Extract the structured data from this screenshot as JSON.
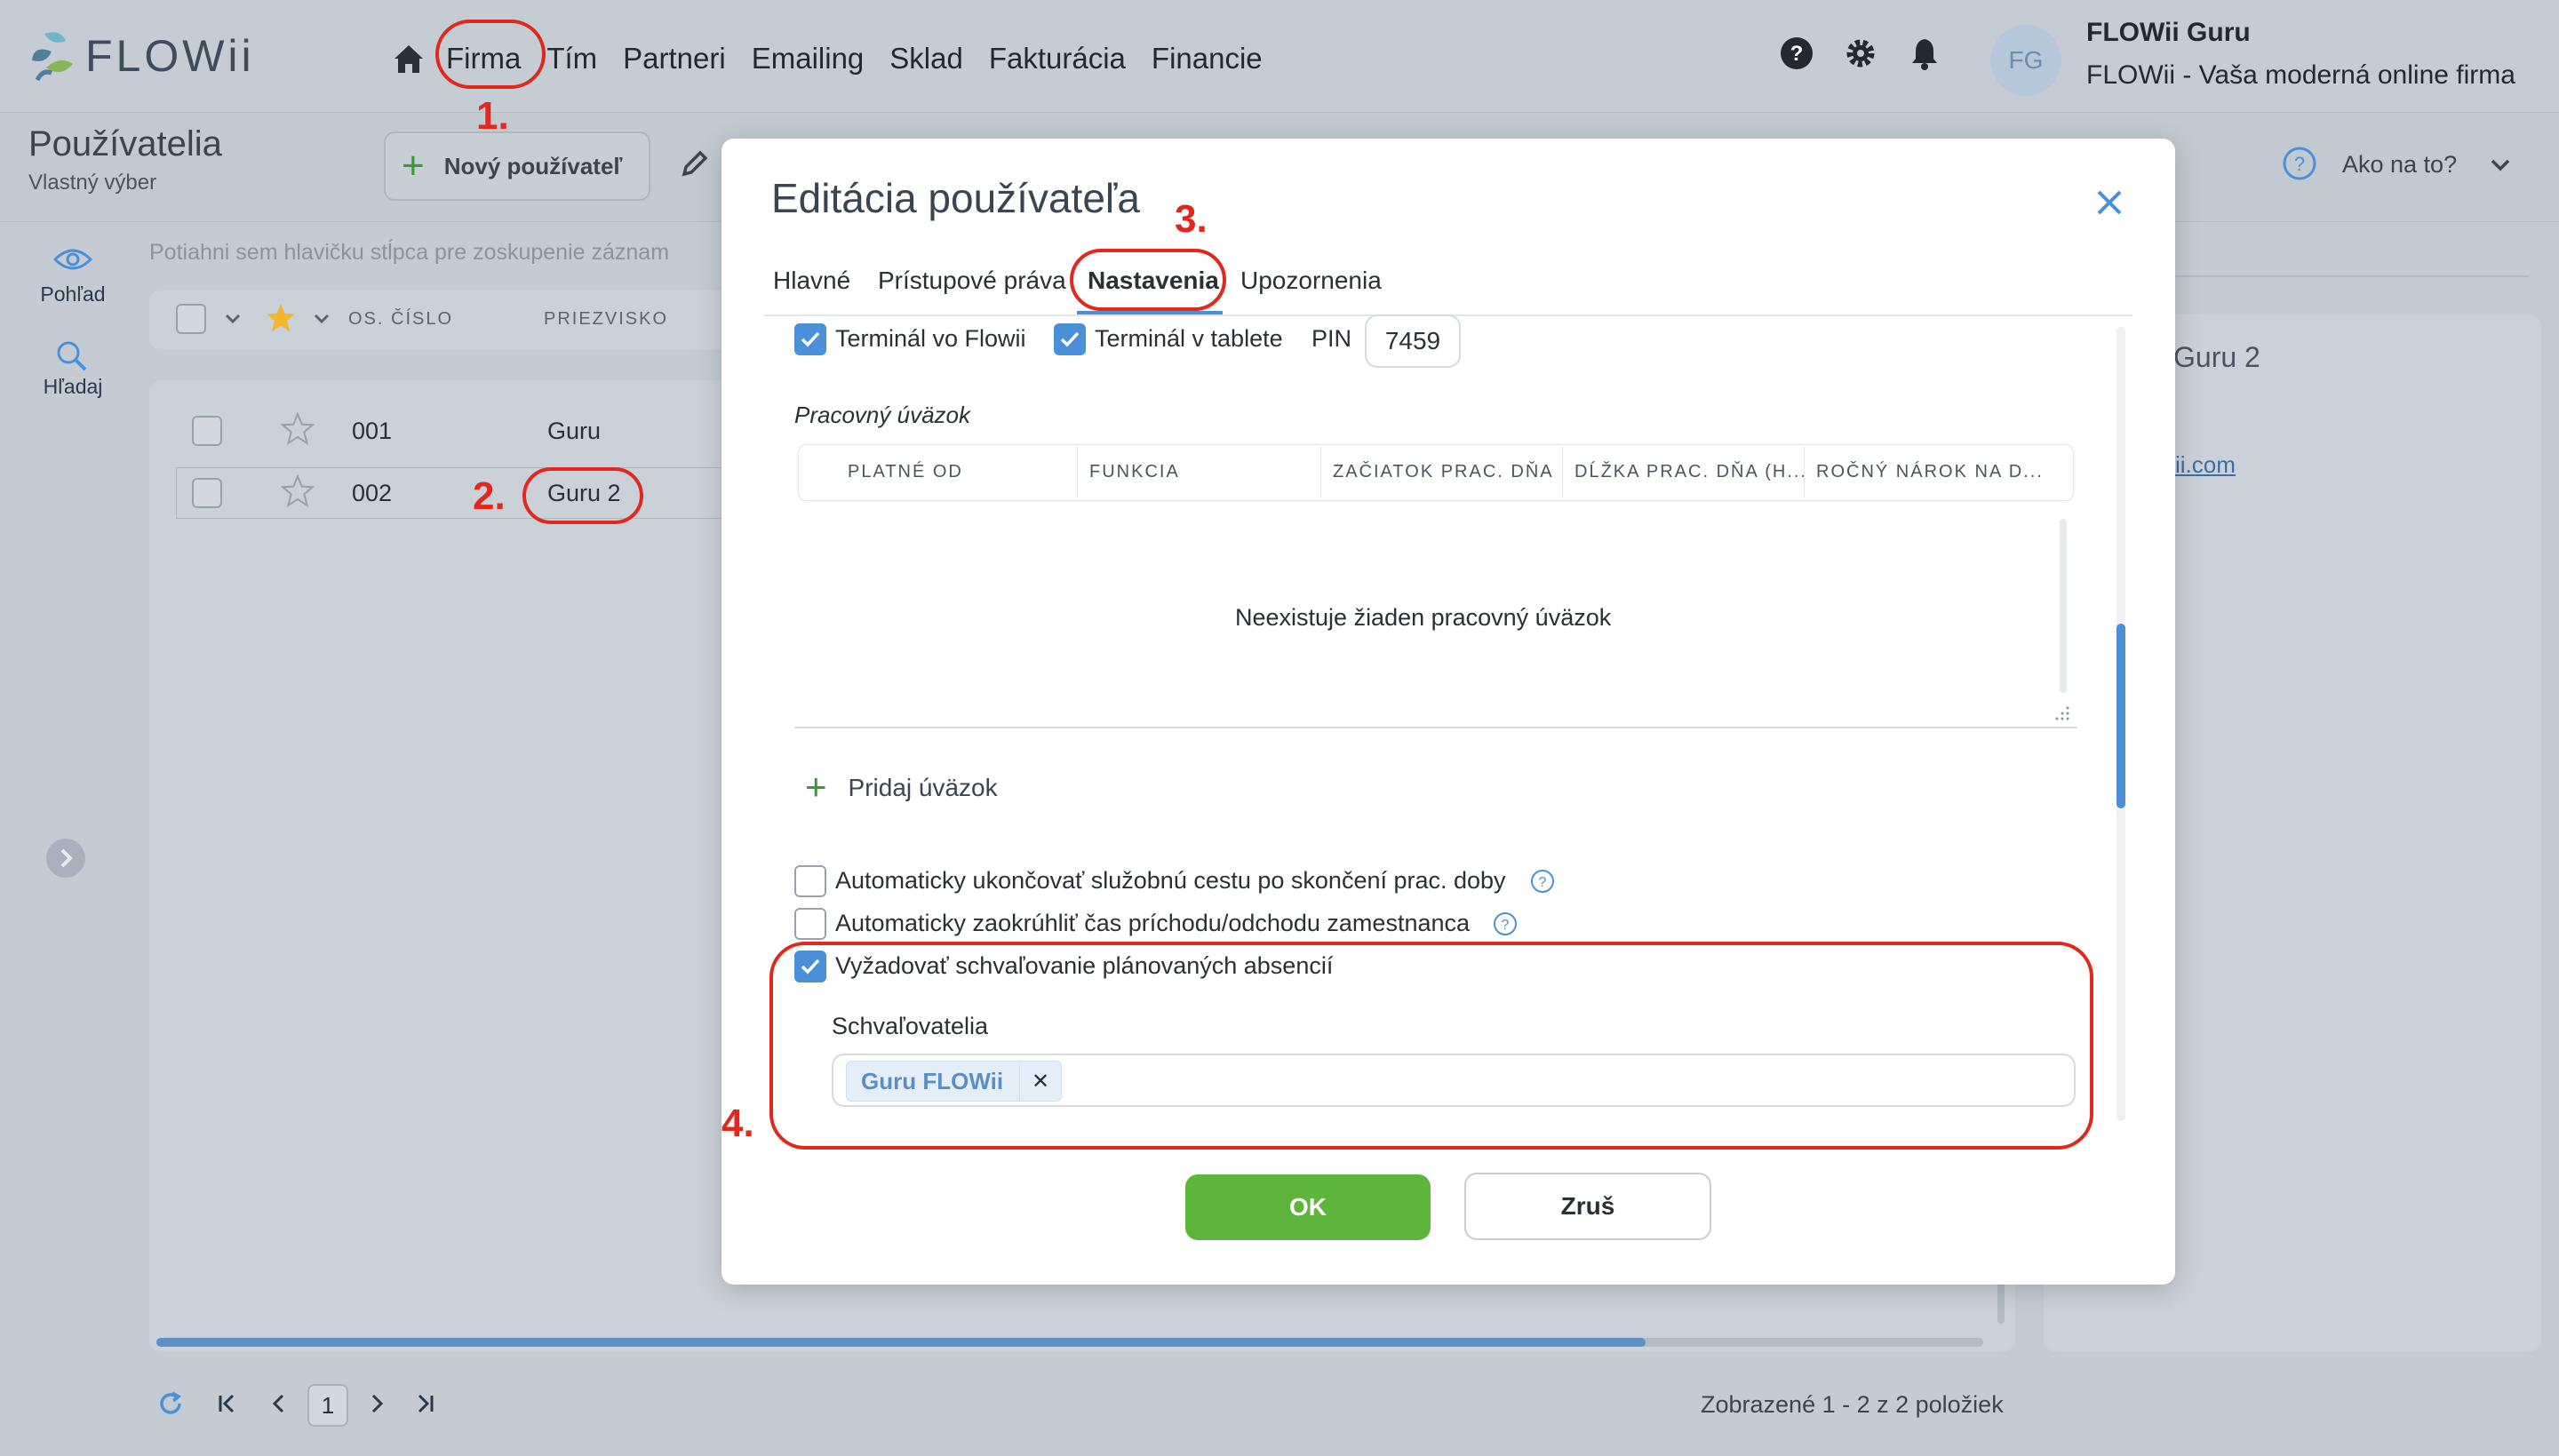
{
  "app": {
    "logo_text": "FLOWii",
    "nav": [
      "Firma",
      "Tím",
      "Partneri",
      "Emailing",
      "Sklad",
      "Fakturácia",
      "Financie"
    ],
    "user": {
      "initials": "FG",
      "name": "FLOWii Guru",
      "company": "FLOWii - Vaša moderná online firma"
    }
  },
  "page": {
    "title": "Používatelia",
    "subtitle": "Vlastný výber",
    "new_user_label": "Nový používateľ",
    "help_label": "Ako na to?",
    "rail": {
      "view_label": "Pohľad",
      "search_label": "Hľadaj"
    },
    "group_hint": "Potiahni sem hlavičku stĺpca pre zoskupenie záznam",
    "columns": {
      "number": "OS. ČÍSLO",
      "nickname": "PRIEZVISKO"
    },
    "rows": [
      {
        "number": "001",
        "nickname": "Guru"
      },
      {
        "number": "002",
        "nickname": "Guru 2"
      }
    ],
    "right_panel": {
      "name": "Guru 2",
      "link": "ii.com"
    },
    "pager": {
      "page": "1",
      "count_text": "Zobrazené 1 - 2 z 2 položiek"
    }
  },
  "modal": {
    "title": "Editácia používateľa",
    "tabs": [
      "Hlavné",
      "Prístupové práva",
      "Nastavenia",
      "Upozornenia"
    ],
    "active_tab": "Nastavenia",
    "terminal_flowii": "Terminál vo Flowii",
    "terminal_tablet": "Terminál v tablete",
    "pin_label": "PIN",
    "pin_value": "7459",
    "workload": {
      "section_title": "Pracovný úväzok",
      "columns": [
        "PLATNÉ OD",
        "FUNKCIA",
        "ZAČIATOK PRAC. DŇA",
        "DĹŽKA PRAC. DŇA (H...",
        "ROČNÝ NÁROK NA D..."
      ],
      "empty_text": "Neexistuje žiaden pracovný úväzok",
      "add_label": "Pridaj úväzok"
    },
    "options": {
      "auto_end_trip": "Automaticky ukončovať služobnú cestu po skončení prac. doby",
      "auto_round": "Automaticky zaokrúhliť čas príchodu/odchodu zamestnanca",
      "require_approval": "Vyžadovať schvaľovanie plánovaných absencií"
    },
    "approvers_label": "Schvaľovatelia",
    "approvers": [
      "Guru FLOWii"
    ],
    "ok_label": "OK",
    "cancel_label": "Zruš"
  },
  "annotations": [
    "1.",
    "2.",
    "3.",
    "4."
  ],
  "colors": {
    "accent": "#4a90d9",
    "ok_green": "#5db53b",
    "annotation_red": "#e0281c"
  }
}
